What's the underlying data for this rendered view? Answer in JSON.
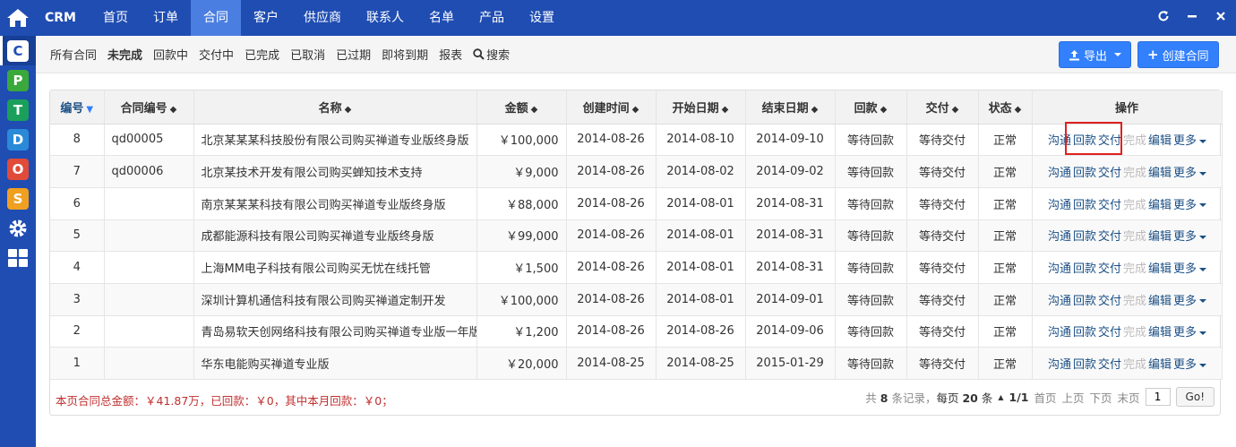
{
  "brand": "CRM",
  "nav": [
    "首页",
    "订单",
    "合同",
    "客户",
    "供应商",
    "联系人",
    "名单",
    "产品",
    "设置"
  ],
  "nav_active": 2,
  "left_apps": [
    {
      "letter": "C",
      "color": "#1f4db2",
      "name": "crm"
    },
    {
      "letter": "P",
      "color": "#3aa83a",
      "name": "project"
    },
    {
      "letter": "T",
      "color": "#1aa05a",
      "name": "team"
    },
    {
      "letter": "D",
      "color": "#2a8ad8",
      "name": "doc"
    },
    {
      "letter": "O",
      "color": "#e04b3a",
      "name": "oa"
    },
    {
      "letter": "S",
      "color": "#f0a020",
      "name": "store"
    }
  ],
  "subnav": [
    "所有合同",
    "未完成",
    "回款中",
    "交付中",
    "已完成",
    "已取消",
    "已过期",
    "即将到期",
    "报表"
  ],
  "subnav_active": 1,
  "search_label": "搜索",
  "export_label": "导出",
  "create_label": "创建合同",
  "columns": [
    "编号",
    "合同编号",
    "名称",
    "金额",
    "创建时间",
    "开始日期",
    "结束日期",
    "回款",
    "交付",
    "状态",
    "操作"
  ],
  "rows": [
    {
      "id": "8",
      "code": "qd00005",
      "name": "北京某某某科技股份有限公司购买禅道专业版终身版",
      "amount": "￥100,000",
      "created": "2014-08-26",
      "start": "2014-08-10",
      "end": "2014-09-10",
      "payment": "等待回款",
      "delivery": "等待交付",
      "status": "正常"
    },
    {
      "id": "7",
      "code": "qd00006",
      "name": "北京某技术开发有限公司购买蝉知技术支持",
      "amount": "￥9,000",
      "created": "2014-08-26",
      "start": "2014-08-02",
      "end": "2014-09-02",
      "payment": "等待回款",
      "delivery": "等待交付",
      "status": "正常"
    },
    {
      "id": "6",
      "code": "",
      "name": "南京某某某科技有限公司购买禅道专业版终身版",
      "amount": "￥88,000",
      "created": "2014-08-26",
      "start": "2014-08-01",
      "end": "2014-08-31",
      "payment": "等待回款",
      "delivery": "等待交付",
      "status": "正常"
    },
    {
      "id": "5",
      "code": "",
      "name": "成都能源科技有限公司购买禅道专业版终身版",
      "amount": "￥99,000",
      "created": "2014-08-26",
      "start": "2014-08-01",
      "end": "2014-08-31",
      "payment": "等待回款",
      "delivery": "等待交付",
      "status": "正常"
    },
    {
      "id": "4",
      "code": "",
      "name": "上海MM电子科技有限公司购买无忧在线托管",
      "amount": "￥1,500",
      "created": "2014-08-26",
      "start": "2014-08-01",
      "end": "2014-08-31",
      "payment": "等待回款",
      "delivery": "等待交付",
      "status": "正常"
    },
    {
      "id": "3",
      "code": "",
      "name": "深圳计算机通信科技有限公司购买禅道定制开发",
      "amount": "￥100,000",
      "created": "2014-08-26",
      "start": "2014-08-01",
      "end": "2014-09-01",
      "payment": "等待回款",
      "delivery": "等待交付",
      "status": "正常"
    },
    {
      "id": "2",
      "code": "",
      "name": "青岛易软天创网络科技有限公司购买禅道专业版一年版",
      "amount": "￥1,200",
      "created": "2014-08-26",
      "start": "2014-08-26",
      "end": "2014-09-06",
      "payment": "等待回款",
      "delivery": "等待交付",
      "status": "正常"
    },
    {
      "id": "1",
      "code": "",
      "name": "华东电能购买禅道专业版",
      "amount": "￥20,000",
      "created": "2014-08-25",
      "start": "2014-08-25",
      "end": "2015-01-29",
      "payment": "等待回款",
      "delivery": "等待交付",
      "status": "正常"
    }
  ],
  "actions": [
    "沟通",
    "回款",
    "交付",
    "完成",
    "编辑",
    "更多"
  ],
  "summary": "本页合同总金额：￥41.87万，已回款：￥0，其中本月回款：￥0；",
  "pager": {
    "total_prefix": "共",
    "total": "8",
    "total_suffix": "条记录，",
    "per_prefix": "每页",
    "per": "20",
    "per_suffix": "条",
    "pages": "1/1",
    "first": "首页",
    "prev": "上页",
    "next": "下页",
    "last": "末页",
    "page_value": "1",
    "go": "Go!"
  },
  "colors": {
    "primary": "#1f4db2",
    "link": "#1a4f85",
    "danger": "#c03030",
    "button": "#3280fc"
  }
}
